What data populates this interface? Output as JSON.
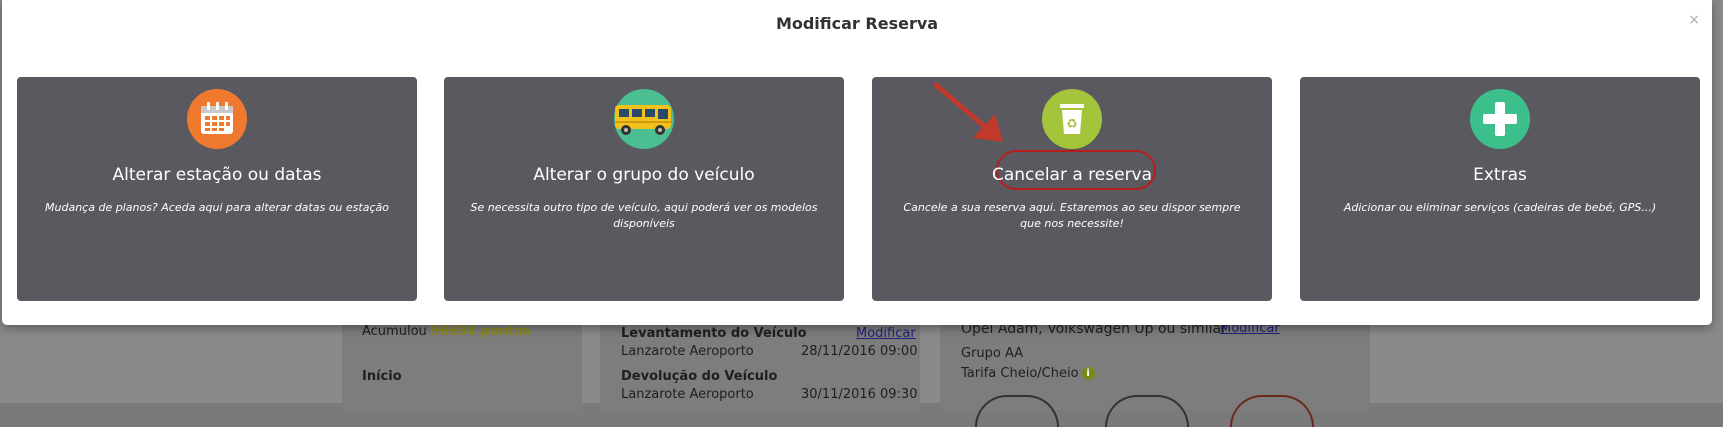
{
  "modal": {
    "title": "Modificar Reserva",
    "close_icon": "×"
  },
  "options": [
    {
      "title": "Alterar estação ou datas",
      "description": "Mudança de planos? Aceda aqui para alterar datas ou estação",
      "icon": "calendar-icon",
      "icon_color": "#ef7a2f"
    },
    {
      "title": "Alterar o grupo do veículo",
      "description": "Se necessita outro tipo de veículo, aqui poderá ver os modelos disponíveis",
      "icon": "bus-icon",
      "icon_color": "#4bbf92"
    },
    {
      "title": "Cancelar a reserva",
      "description": "Cancele a sua reserva aqui. Estaremos ao seu dispor sempre que nos necessite!",
      "icon": "recycle-bin-icon",
      "icon_color": "#a4c43c",
      "highlighted": true
    },
    {
      "title": "Extras",
      "description": "Adicionar ou eliminar serviços (cadeiras de bebé, GPS...)",
      "icon": "plus-icon",
      "icon_color": "#3dbf8c"
    }
  ],
  "background": {
    "points_prefix": "Acumulou",
    "points_value": "96694 pontos",
    "inicio_label": "Início",
    "pickup_title": "Levantamento do Veículo",
    "pickup_modify": "Modificar",
    "pickup_location": "Lanzarote Aeroporto",
    "pickup_date": "28/11/2016",
    "pickup_time": "09:00",
    "return_title": "Devolução do Veículo",
    "return_location": "Lanzarote Aeroporto",
    "return_date": "30/11/2016",
    "return_time": "09:30",
    "car_model": "Opel Adam, Volkswagen Up ou similar",
    "car_modify": "Modificar",
    "car_group": "Grupo AA",
    "tariff": "Tarifa Cheio/Cheio",
    "tariff_info_icon": "info-icon"
  },
  "colors": {
    "card_bg": "#5a5960",
    "highlight": "#b91d1d",
    "points": "#8c8c1a"
  }
}
